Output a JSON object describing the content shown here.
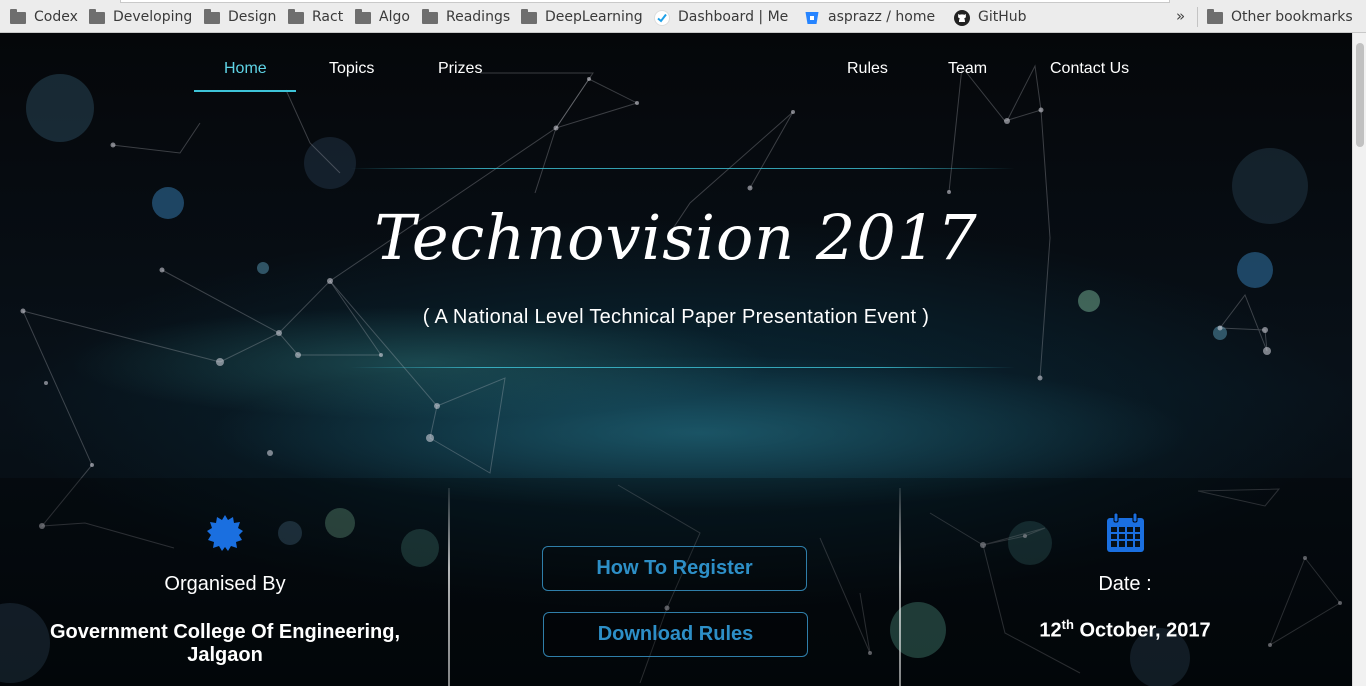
{
  "bookmarks": {
    "items": [
      {
        "label": "Codex",
        "icon": "folder-icon"
      },
      {
        "label": "Developing",
        "icon": "folder-icon"
      },
      {
        "label": "Design",
        "icon": "folder-icon"
      },
      {
        "label": "Ract",
        "icon": "folder-icon"
      },
      {
        "label": "Algo",
        "icon": "folder-icon"
      },
      {
        "label": "Readings",
        "icon": "folder-icon"
      },
      {
        "label": "DeepLearning",
        "icon": "folder-icon"
      },
      {
        "label": "Dashboard | Mei",
        "icon": "checkmark-icon"
      },
      {
        "label": "asprazz / home –",
        "icon": "bitbucket-icon"
      },
      {
        "label": "GitHub",
        "icon": "github-icon"
      }
    ],
    "overflow": "»",
    "other": "Other bookmarks"
  },
  "nav": {
    "items": [
      "Home",
      "Topics",
      "Prizes",
      "Rules",
      "Team",
      "Contact Us"
    ],
    "active": "Home"
  },
  "hero": {
    "title": "Technovision 2017",
    "subtitle": "( A National Level Technical Paper Presentation Event )"
  },
  "organiser": {
    "label": "Organised By",
    "name": "Government College Of Engineering, Jalgaon",
    "icon": "badge-icon"
  },
  "actions": {
    "register": "How To Register",
    "download": "Download Rules"
  },
  "date": {
    "label": "Date :",
    "day": "12",
    "suffix": "th",
    "rest": " October, 2017",
    "icon": "calendar-icon"
  },
  "colors": {
    "accent": "#3ec4d8",
    "button_text": "#2d8fc7",
    "icon_blue": "#1a6fe0"
  }
}
